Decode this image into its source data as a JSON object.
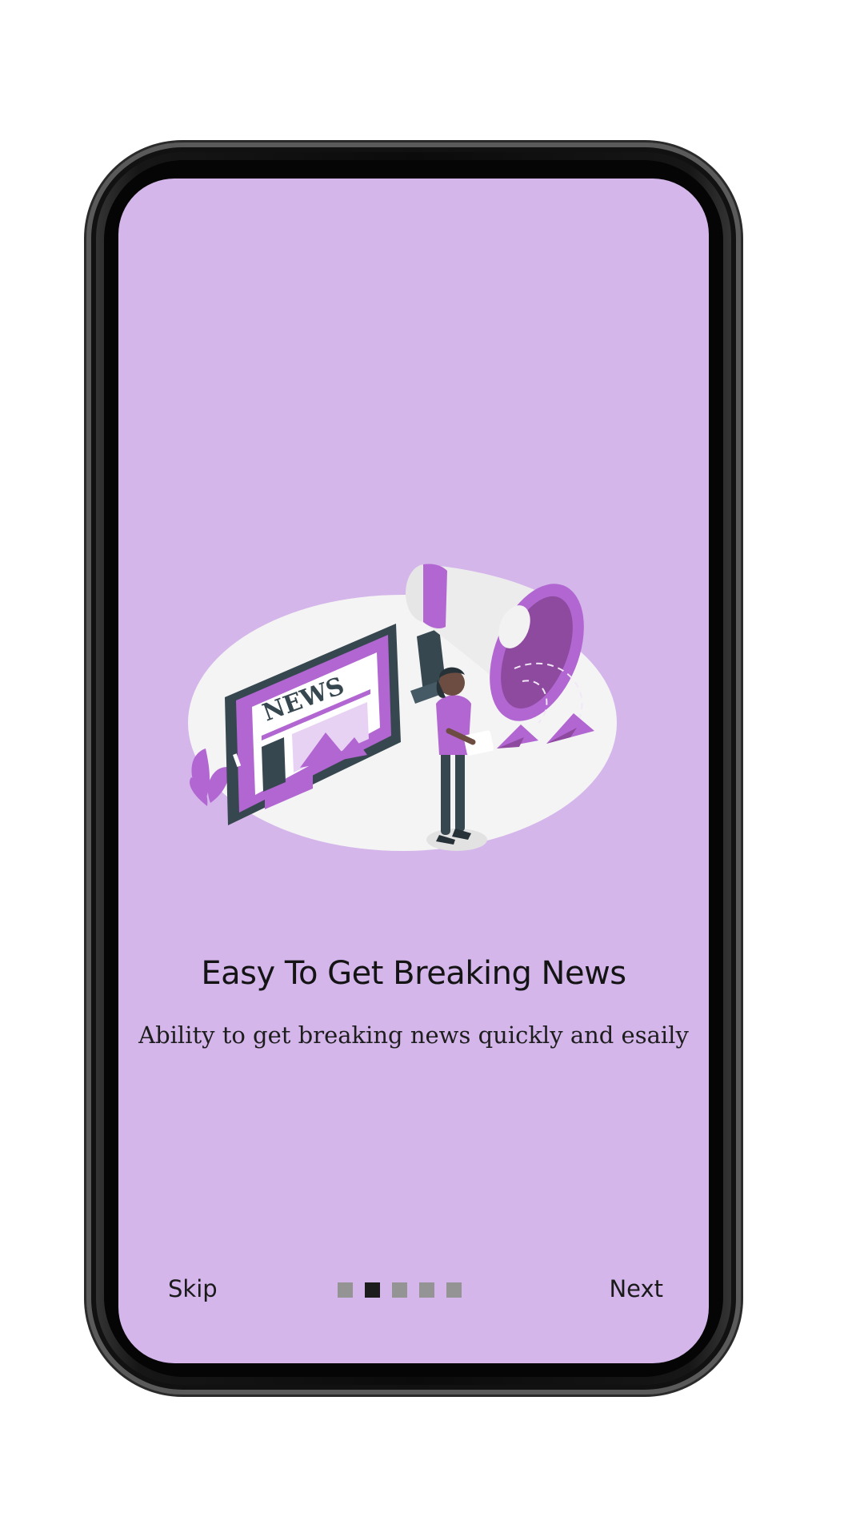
{
  "onboarding": {
    "title": "Easy To Get Breaking News",
    "subtitle": "Ability to get breaking news quickly and esaily",
    "illustration_label": "NEWS"
  },
  "navigation": {
    "skip_label": "Skip",
    "next_label": "Next",
    "page_count": 5,
    "active_page": 2
  },
  "colors": {
    "screen_background": "#d4b6eb",
    "accent": "#b166d1",
    "dot_active": "#1c1c1c",
    "dot_inactive": "#949494"
  }
}
